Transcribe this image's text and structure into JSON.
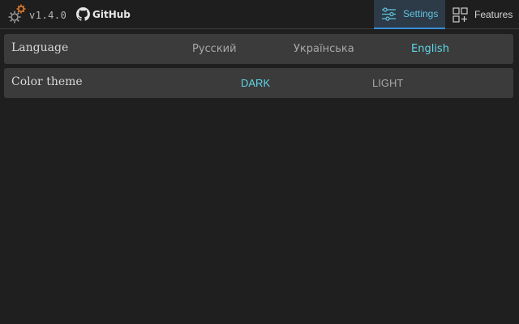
{
  "header": {
    "version": "v1.4.0",
    "github_label": "GitHub",
    "logo_icon": "gear-logo-icon",
    "tabs": [
      {
        "label": "Settings",
        "icon": "sliders-icon",
        "active": true
      },
      {
        "label": "Features",
        "icon": "blocks-plus-icon",
        "active": false
      }
    ]
  },
  "settings": {
    "language": {
      "label": "Language",
      "options": [
        "Русский",
        "Українська",
        "English"
      ],
      "selected": "English"
    },
    "theme": {
      "label": "Color theme",
      "options": [
        "DARK",
        "LIGHT"
      ],
      "selected": "DARK"
    }
  },
  "colors": {
    "accent": "#5ed6e8",
    "logo_orange": "#e07b2c",
    "background": "#1f1f1f",
    "row_background": "#3b3b3b",
    "active_tab": "#2d3a47"
  }
}
